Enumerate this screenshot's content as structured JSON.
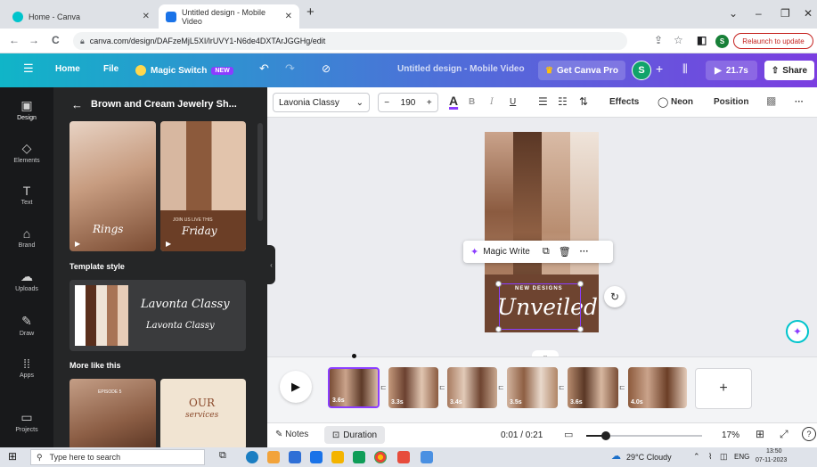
{
  "browser": {
    "tabs": [
      {
        "title": "Home - Canva",
        "active": false
      },
      {
        "title": "Untitled design - Mobile Video",
        "active": true
      }
    ],
    "new_tab": "+",
    "url": "canva.com/design/DAFzeMjL5XI/lrUVY1-N6de4DXTArJGGHg/edit",
    "relaunch_label": "Relaunch to update",
    "profile_initial": "S",
    "window_controls": {
      "minimize": "–",
      "restore": "❐",
      "close": "✕",
      "chevron": "⌄"
    }
  },
  "header": {
    "menu_icon": "☰",
    "home": "Home",
    "file": "File",
    "magic_switch": "Magic Switch",
    "new_badge": "NEW",
    "doc_title": "Untitled design - Mobile Video",
    "get_pro": "Get Canva Pro",
    "avatar_initial": "S",
    "duration": "21.7s",
    "share": "Share"
  },
  "rail": [
    {
      "label": "Design",
      "icon": "▣"
    },
    {
      "label": "Elements",
      "icon": "◇"
    },
    {
      "label": "Text",
      "icon": "T"
    },
    {
      "label": "Brand",
      "icon": "⌂"
    },
    {
      "label": "Uploads",
      "icon": "☁"
    },
    {
      "label": "Draw",
      "icon": "✎"
    },
    {
      "label": "Apps",
      "icon": "⁞⁞"
    },
    {
      "label": "Projects",
      "icon": "▭"
    }
  ],
  "panel": {
    "back": "←",
    "title": "Brown and Cream Jewelry Sh...",
    "thumb1_text": "Rings",
    "thumb2_small": "JOIN US LIVE THIS",
    "thumb2_text": "Friday",
    "template_style": "Template style",
    "font_preview_1": "Lavonta Classy",
    "font_preview_2": "Lavonta Classy",
    "more_like_this": "More like this",
    "more1_small": "EPISODE 5",
    "more2_title": "OUR",
    "more2_sub": "services"
  },
  "toolbar": {
    "font": "Lavonia Classy",
    "size": "190",
    "minus": "−",
    "plus": "+",
    "bold": "B",
    "italic": "I",
    "underline": "U",
    "effects": "Effects",
    "neon": "Neon",
    "position": "Position",
    "more": "···"
  },
  "canvas": {
    "magic_write": "Magic Write",
    "headline_small": "NEW DESIGNS",
    "headline": "Unveiled",
    "more": "···"
  },
  "timeline": {
    "clips": [
      "3.6s",
      "3.3s",
      "3.4s",
      "3.5s",
      "3.6s",
      "4.0s"
    ],
    "add": "+"
  },
  "bottom": {
    "notes": "Notes",
    "duration": "Duration",
    "time": "0:01 / 0:21",
    "zoom": "17%",
    "zoom_fraction": 0.17,
    "help": "?"
  },
  "taskbar": {
    "search_placeholder": "Type here to search",
    "weather": "29°C Cloudy",
    "lang": "ENG",
    "time": "13:50",
    "date": "07-11-2023"
  },
  "colors": {
    "header_start": "#10b5c8",
    "header_end": "#7b3ee0",
    "accent": "#8b3dff",
    "rail_bg": "#18191b",
    "panel_bg": "#252627"
  }
}
